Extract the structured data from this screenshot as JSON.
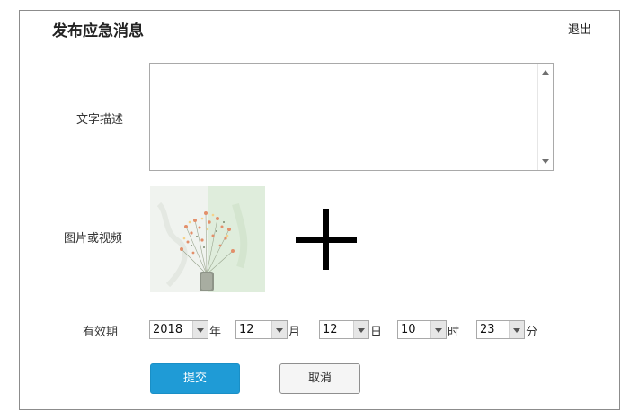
{
  "header": {
    "title": "发布应急消息",
    "logout_label": "退出"
  },
  "form": {
    "text_label": "文字描述",
    "text_value": "",
    "media_label": "图片或视频",
    "media_add_icon": "plus-icon",
    "validity_label": "有效期",
    "year": {
      "value": "2018",
      "unit": "年"
    },
    "month": {
      "value": "12",
      "unit": "月"
    },
    "day": {
      "value": "12",
      "unit": "日"
    },
    "hour": {
      "value": "10",
      "unit": "时"
    },
    "minute": {
      "value": "23",
      "unit": "分"
    },
    "submit_label": "提交",
    "cancel_label": "取消"
  },
  "colors": {
    "submit_bg": "#1f9bd6",
    "border": "#8c8c8c"
  }
}
